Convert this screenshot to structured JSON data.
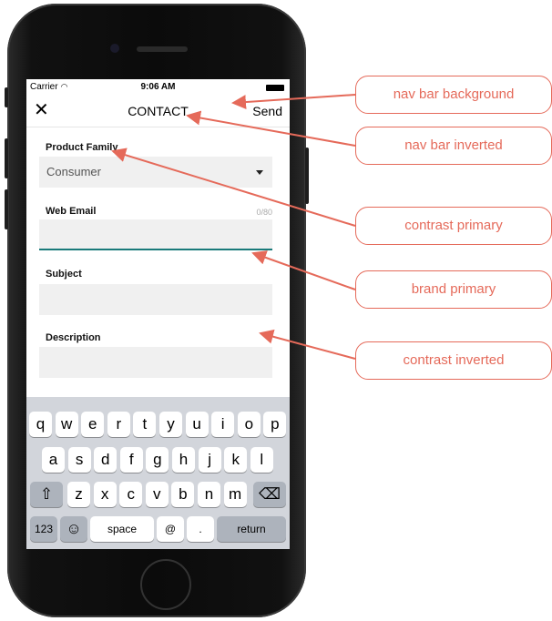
{
  "status_bar": {
    "carrier": "Carrier",
    "time": "9:06 AM"
  },
  "nav": {
    "title": "CONTACT",
    "send_label": "Send",
    "close_icon": "close-icon"
  },
  "form": {
    "product_family": {
      "label": "Product Family",
      "value": "Consumer"
    },
    "web_email": {
      "label": "Web Email",
      "counter": "0/80",
      "value": ""
    },
    "subject": {
      "label": "Subject",
      "value": ""
    },
    "description": {
      "label": "Description",
      "value": ""
    }
  },
  "keyboard": {
    "row1": [
      "q",
      "w",
      "e",
      "r",
      "t",
      "y",
      "u",
      "i",
      "o",
      "p"
    ],
    "row2": [
      "a",
      "s",
      "d",
      "f",
      "g",
      "h",
      "j",
      "k",
      "l"
    ],
    "row3": [
      "z",
      "x",
      "c",
      "v",
      "b",
      "n",
      "m"
    ],
    "numbers_label": "123",
    "space_label": "space",
    "at_label": "@",
    "dot_label": ".",
    "return_label": "return"
  },
  "annotations": [
    {
      "label": "nav bar background"
    },
    {
      "label": "nav bar inverted"
    },
    {
      "label": "contrast primary"
    },
    {
      "label": "brand primary"
    },
    {
      "label": "contrast inverted"
    }
  ],
  "colors": {
    "annotation": "#e56a5a",
    "brand_primary": "#1a7a7a",
    "field_bg": "#f0f0f0",
    "keyboard_bg": "#d2d5db"
  }
}
